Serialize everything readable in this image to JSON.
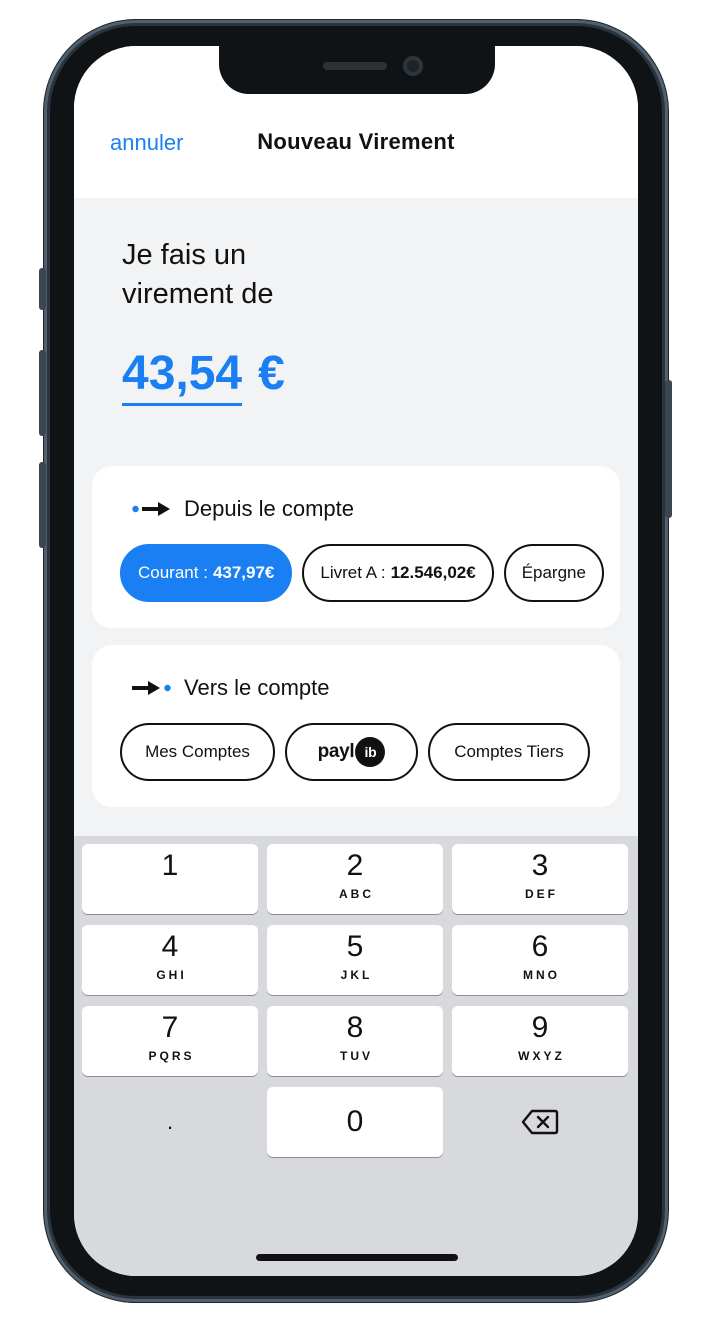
{
  "header": {
    "cancel_label": "annuler",
    "title": "Nouveau Virement"
  },
  "intro": {
    "line1": "Je fais un",
    "line2": "virement de"
  },
  "amount": {
    "value": "43,54",
    "currency": "€"
  },
  "from_section": {
    "title": "Depuis le compte",
    "accounts": [
      {
        "name": "Courant :",
        "balance": "437,97€",
        "selected": true
      },
      {
        "name": "Livret A :",
        "balance": "12.546,02€",
        "selected": false
      },
      {
        "name": "Épargne",
        "balance": "",
        "selected": false
      }
    ]
  },
  "to_section": {
    "title": "Vers le compte",
    "options": {
      "my_accounts": "Mes Comptes",
      "paylib_text": "payl",
      "paylib_circle": "ib",
      "third_party": "Comptes Tiers"
    }
  },
  "keypad": {
    "keys": [
      {
        "num": "1",
        "letters": ""
      },
      {
        "num": "2",
        "letters": "ABC"
      },
      {
        "num": "3",
        "letters": "DEF"
      },
      {
        "num": "4",
        "letters": "GHI"
      },
      {
        "num": "5",
        "letters": "JKL"
      },
      {
        "num": "6",
        "letters": "MNO"
      },
      {
        "num": "7",
        "letters": "PQRS"
      },
      {
        "num": "8",
        "letters": "TUV"
      },
      {
        "num": "9",
        "letters": "WXYZ"
      },
      {
        "num": "0",
        "letters": ""
      }
    ],
    "decimal": ".",
    "delete_icon": "backspace-icon"
  },
  "colors": {
    "accent": "#1a7ff3",
    "text": "#111111",
    "background": "#f2f3f5",
    "keypad_bg": "#d7d9dd"
  }
}
